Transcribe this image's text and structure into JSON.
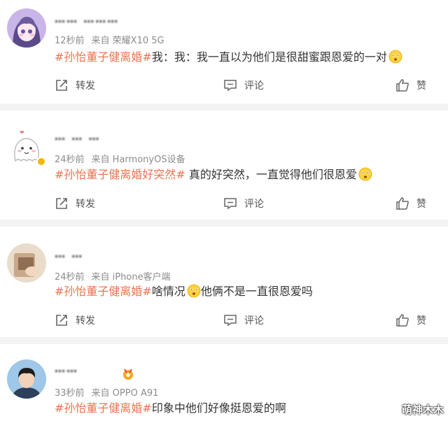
{
  "posts": [
    {
      "username": "…… ………",
      "time": "12秒前",
      "source": "来自 荣耀X10 5G",
      "hashtag": "#孙怡董子健离婚#",
      "text": "我：我：我一直以为他们是很甜蜜跟恩爱的一对",
      "emoji": "flushed-emoji"
    },
    {
      "username": "… … …",
      "time": "24秒前",
      "source": "来自 HarmonyOS设备",
      "hashtag": "#孙怡董子健离婚好突然#",
      "text": " 真的好突然，一直觉得他们很恩爱",
      "emoji": "flushed-emoji"
    },
    {
      "username": "… …",
      "time": "24秒前",
      "source": "来自 iPhone客户端",
      "hashtag": "#孙怡董子健离婚#",
      "text": "啥情况",
      "text2": "他俩不是一直很恩爱吗",
      "emoji": "flushed-emoji"
    },
    {
      "username": "……",
      "time": "33秒前",
      "source": "来自 OPPO A91",
      "hashtag": "#孙怡董子健离婚#",
      "text": "印象中他们好像挺恩爱的啊"
    }
  ],
  "actions": {
    "share_label": "转发",
    "comment_label": "评论",
    "like_label": "赞"
  },
  "watermark": "萌神木木",
  "colors": {
    "hashtag": "#eb7350",
    "meta": "#8c8c8c",
    "separator": "#f3f3f3"
  }
}
